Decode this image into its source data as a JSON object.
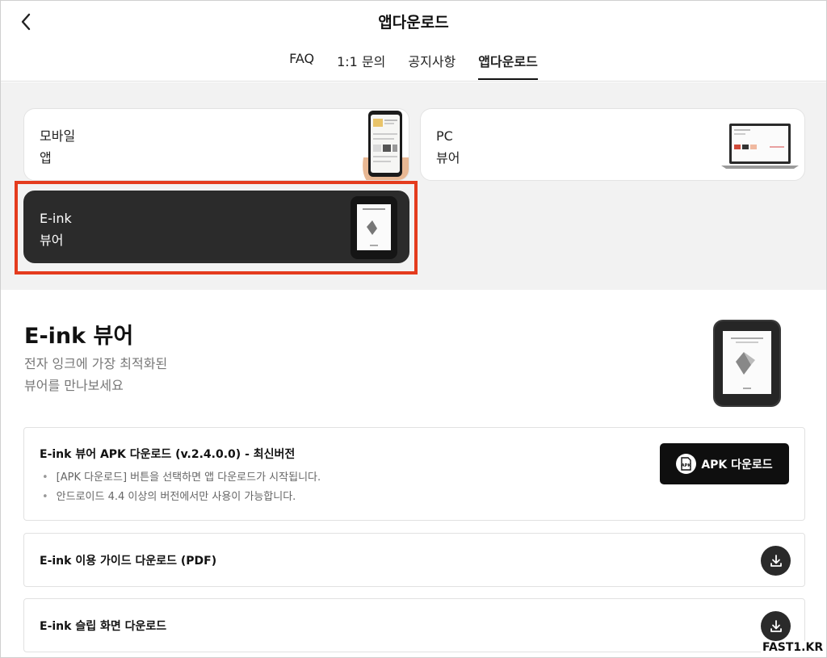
{
  "header": {
    "title": "앱다운로드",
    "tabs": [
      {
        "label": "FAQ",
        "active": false
      },
      {
        "label": "1:1 문의",
        "active": false
      },
      {
        "label": "공지사항",
        "active": false
      },
      {
        "label": "앱다운로드",
        "active": true
      }
    ]
  },
  "cards": {
    "mobile": "모바일\n앱",
    "pc": "PC\n뷰어",
    "eink": "E-ink\n뷰어"
  },
  "section": {
    "title": "E-ink 뷰어",
    "desc_line1": "전자 잉크에 가장 최적화된",
    "desc_line2": "뷰어를 만나보세요"
  },
  "apk": {
    "title": "E-ink 뷰어 APK 다운로드 (v.2.4.0.0) - 최신버전",
    "note1": "[APK 다운로드] 버튼을 선택하면 앱 다운로드가 시작됩니다.",
    "note2": "안드로이드 4.4 이상의 버전에서만 사용이 가능합니다.",
    "button_label": "APK 다운로드",
    "icon_text": "APK"
  },
  "downloads": [
    {
      "label": "E-ink 이용 가이드 다운로드 (PDF)"
    },
    {
      "label": "E-ink 슬립 화면 다운로드"
    }
  ],
  "watermark": "FAST1.KR",
  "colors": {
    "highlight": "#e43b1d",
    "dark_card": "#2b2b2b",
    "apk_button": "#0f0f0f"
  }
}
